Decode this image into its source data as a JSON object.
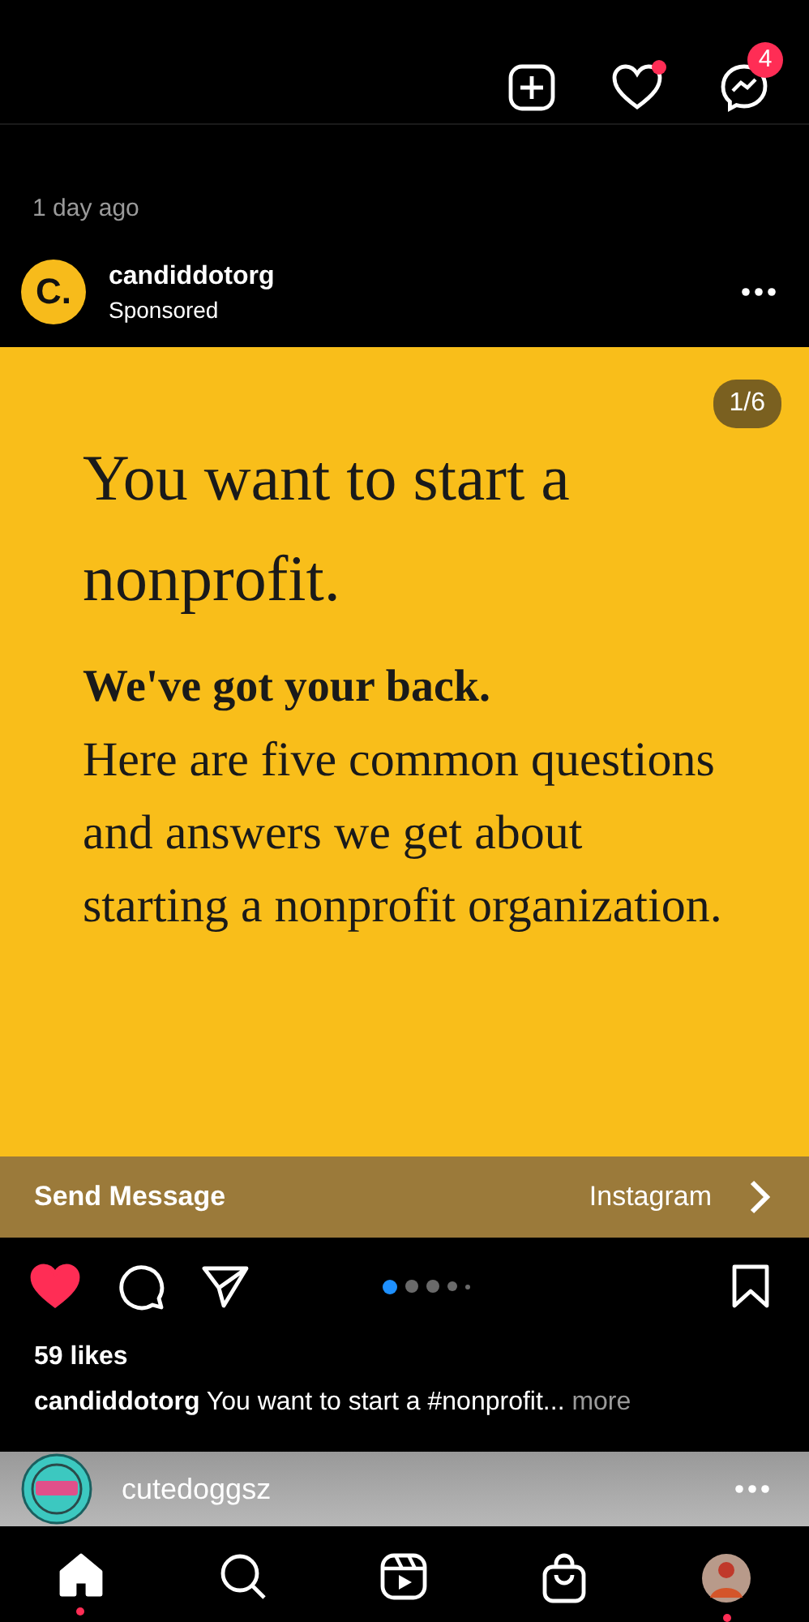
{
  "header": {
    "notifications_unread": true,
    "messages_badge": "4"
  },
  "previous_post": {
    "time": "1 day ago"
  },
  "post": {
    "username": "candiddotorg",
    "avatar_letter": "C.",
    "label": "Sponsored",
    "slide": {
      "counter": "1/6",
      "headline": "You want to start a nonprofit.",
      "subhead": "We've got your back.",
      "body": "Here are five common questions and answers we get about starting a nonprofit organization."
    },
    "cta": {
      "label": "Send Message",
      "source": "Instagram"
    },
    "liked": true,
    "saved": false,
    "dots": [
      {
        "selected": true
      },
      {
        "selected": false
      },
      {
        "selected": false
      },
      {
        "selected": false
      },
      {
        "selected": false
      }
    ],
    "likes": "59 likes",
    "caption_user": "candiddotorg",
    "caption": "You want to start a #nonprofit...",
    "more": "more"
  },
  "next_post": {
    "username": "cutedoggsz"
  },
  "nav": [
    {
      "kind": "home",
      "selected": true,
      "dot": true
    },
    {
      "kind": "search",
      "selected": false,
      "dot": false
    },
    {
      "kind": "reels",
      "selected": false,
      "dot": false
    },
    {
      "kind": "shop",
      "selected": false,
      "dot": false
    },
    {
      "kind": "profile",
      "selected": false,
      "dot": true
    }
  ]
}
